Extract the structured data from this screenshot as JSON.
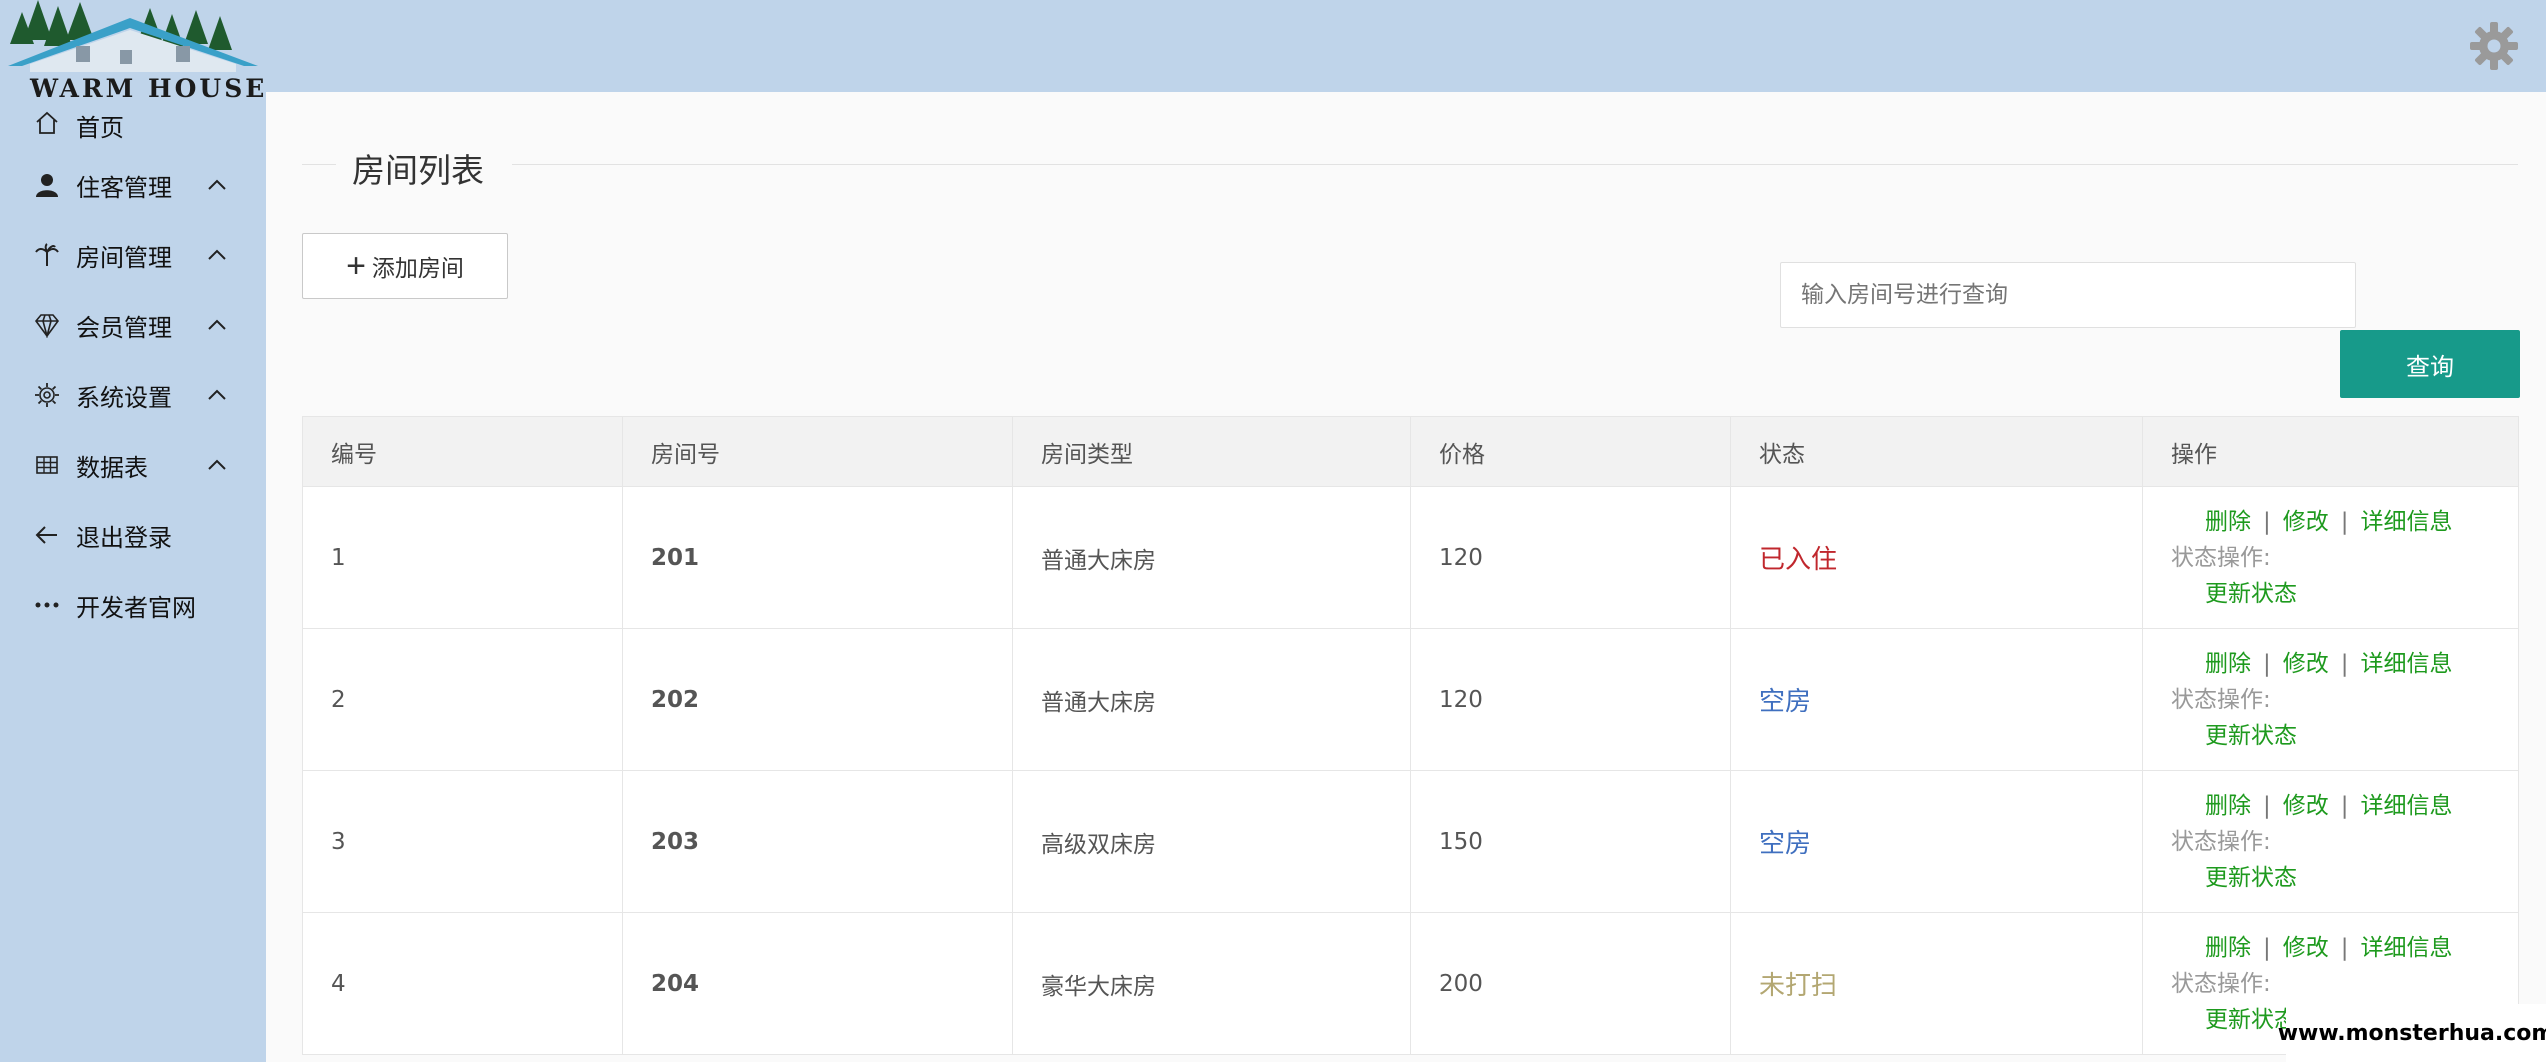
{
  "brand": {
    "logo_text": "WARM HOUSE"
  },
  "sidebar": {
    "items": [
      {
        "label": "首页",
        "icon": "home-icon",
        "expandable": false
      },
      {
        "label": "住客管理",
        "icon": "user-icon",
        "expandable": true
      },
      {
        "label": "房间管理",
        "icon": "palm-icon",
        "expandable": true
      },
      {
        "label": "会员管理",
        "icon": "diamond-icon",
        "expandable": true
      },
      {
        "label": "系统设置",
        "icon": "gear-icon",
        "expandable": true
      },
      {
        "label": "数据表",
        "icon": "table-icon",
        "expandable": true
      },
      {
        "label": "退出登录",
        "icon": "arrow-left-icon",
        "expandable": false
      },
      {
        "label": "开发者官网",
        "icon": "more-icon",
        "expandable": false
      }
    ]
  },
  "header": {
    "settings_icon": "gear-icon"
  },
  "main": {
    "title": "房间列表",
    "add_button": "添加房间",
    "search": {
      "placeholder": "输入房间号进行查询",
      "value": ""
    },
    "query_button": "查询",
    "table": {
      "columns": [
        "编号",
        "房间号",
        "房间类型",
        "价格",
        "状态",
        "操作"
      ],
      "rows": [
        {
          "id": "1",
          "room": "201",
          "type": "普通大床房",
          "price": "120",
          "status": "已入住",
          "status_color": "#c0272d"
        },
        {
          "id": "2",
          "room": "202",
          "type": "普通大床房",
          "price": "120",
          "status": "空房",
          "status_color": "#3f6fbf"
        },
        {
          "id": "3",
          "room": "203",
          "type": "高级双床房",
          "price": "150",
          "status": "空房",
          "status_color": "#3f6fbf"
        },
        {
          "id": "4",
          "room": "204",
          "type": "豪华大床房",
          "price": "200",
          "status": "未打扫",
          "status_color": "#b3a772"
        }
      ],
      "ops": {
        "delete": "删除",
        "edit": "修改",
        "details": "详细信息",
        "separator": "|",
        "status_label": "状态操作:",
        "update_status": "更新状态"
      }
    }
  },
  "watermark": "www.monsterhua.com",
  "colors": {
    "sidebar_bg": "#bfd4ea",
    "accent": "#179a8a",
    "op_link": "#1e9a1e"
  }
}
